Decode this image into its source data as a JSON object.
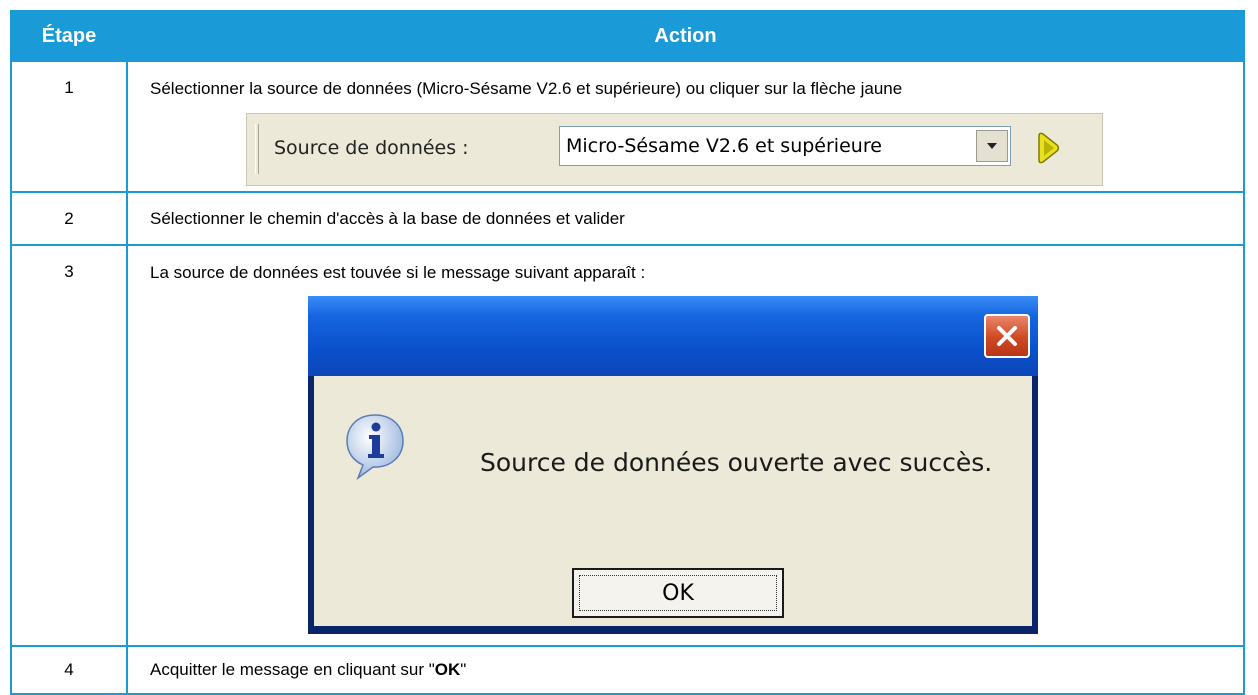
{
  "table": {
    "headers": {
      "step": "Étape",
      "action": "Action"
    },
    "rows": [
      {
        "step": "1",
        "text": "Sélectionner la source de données (Micro-Sésame V2.6 et supérieure) ou cliquer sur la flèche jaune"
      },
      {
        "step": "2",
        "text": "Sélectionner le chemin d'accès à la base de données et valider"
      },
      {
        "step": "3",
        "text": "La source de données est touvée si le message suivant apparaît :"
      },
      {
        "step": "4",
        "text_before": "Acquitter le message en cliquant sur \"",
        "text_bold": "OK",
        "text_after": "\""
      }
    ]
  },
  "datasource_strip": {
    "label": "Source de données :",
    "selected_value": "Micro-Sésame V2.6 et supérieure",
    "go_icon": "yellow-arrow-icon"
  },
  "dialog": {
    "message": "Source de données ouverte avec succès.",
    "ok_label": "OK",
    "icon": "info-icon",
    "close_icon": "close-icon"
  },
  "colors": {
    "table_accent": "#1a9ad6",
    "xp_title_blue": "#0a4fc9",
    "xp_close_red": "#cf4a23",
    "xp_face": "#ece9d8"
  }
}
